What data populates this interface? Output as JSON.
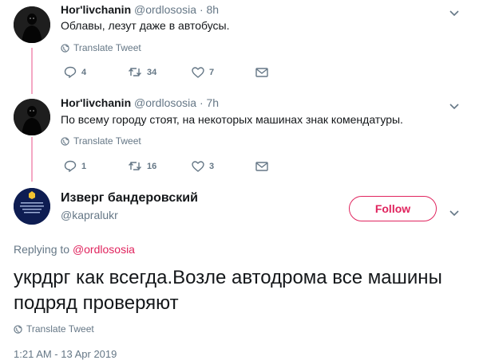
{
  "replies": [
    {
      "display_name": "Hor'livchanin",
      "handle": "@ordlososia",
      "time": "· 8h",
      "text": "Облавы, лезут даже в автобусы.",
      "translate_label": "Translate Tweet",
      "replies_count": "4",
      "retweets_count": "34",
      "likes_count": "7"
    },
    {
      "display_name": "Hor'livchanin",
      "handle": "@ordlososia",
      "time": "· 7h",
      "text": "По всему городу стоят, на некоторых машинах знак комендатуры.",
      "translate_label": "Translate Tweet",
      "replies_count": "1",
      "retweets_count": "16",
      "likes_count": "3"
    }
  ],
  "main_tweet": {
    "display_name": "Изверг бандеровский",
    "handle": "@kapralukr",
    "follow_label": "Follow",
    "replying_prefix": "Replying to",
    "replying_to": "@ordlososia",
    "text": "укрдрг как всегда.Возле автодрома все машины подряд проверяют",
    "translate_label": "Translate Tweet",
    "timestamp": "1:21 AM - 13 Apr 2019"
  },
  "colors": {
    "accent": "#e0245e",
    "thread_line": "#f4a8c4",
    "muted": "#657786"
  }
}
